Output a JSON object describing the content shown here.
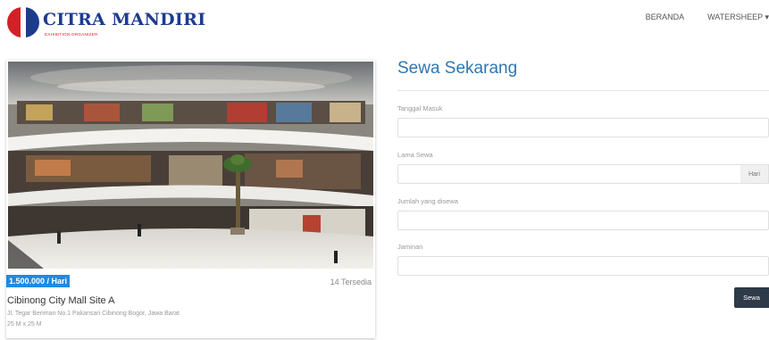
{
  "header": {
    "brand": "CITRA MANDIRI",
    "brand_sub": "EXHIBITION ORGANIZER",
    "nav": [
      {
        "label": "BERANDA"
      },
      {
        "label": "WATERSHEEP ▾"
      }
    ]
  },
  "venue": {
    "price": "1.500.000 / Hari",
    "available": "14 Tersedia",
    "name": "Cibinong City Mall Site A",
    "address": "Jl. Tegar Beriman No.1 Pakansari Cibinong Bogor, Jawa Barat",
    "size": "25 M x 25 M"
  },
  "form": {
    "title": "Sewa Sekarang",
    "fields": [
      {
        "label": "Tanggal Masuk",
        "value": "",
        "placeholder": ""
      },
      {
        "label": "Lama Sewa",
        "value": "",
        "placeholder": "",
        "addon": "Hari"
      },
      {
        "label": "Jumlah yang disewa",
        "value": "",
        "placeholder": ""
      },
      {
        "label": "Jaminan",
        "value": "",
        "placeholder": ""
      }
    ],
    "submit": "Sewa"
  },
  "colors": {
    "brand_blue": "#1c3b8f",
    "brand_red": "#d42027",
    "title_blue": "#2e76b1",
    "badge_blue": "#1f8ae0",
    "button_dark": "#2d3a48"
  }
}
